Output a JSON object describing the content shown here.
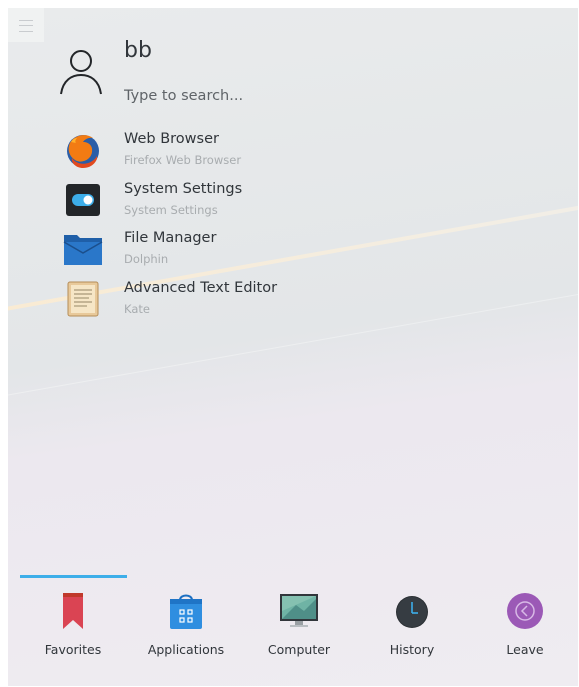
{
  "user": {
    "name": "bb"
  },
  "search": {
    "placeholder": "Type to search..."
  },
  "apps": [
    {
      "title": "Web Browser",
      "subtitle": "Firefox Web Browser",
      "icon": "firefox-icon"
    },
    {
      "title": "System Settings",
      "subtitle": "System Settings",
      "icon": "settings-toggle-icon"
    },
    {
      "title": "File Manager",
      "subtitle": "Dolphin",
      "icon": "folder-icon"
    },
    {
      "title": "Advanced Text Editor",
      "subtitle": "Kate",
      "icon": "text-editor-icon"
    }
  ],
  "tabs": [
    {
      "label": "Favorites",
      "icon": "bookmark-icon",
      "active": true
    },
    {
      "label": "Applications",
      "icon": "app-store-bag-icon",
      "active": false
    },
    {
      "label": "Computer",
      "icon": "monitor-icon",
      "active": false
    },
    {
      "label": "History",
      "icon": "clock-icon",
      "active": false
    },
    {
      "label": "Leave",
      "icon": "leave-icon",
      "active": false
    }
  ],
  "colors": {
    "accent": "#3daee9",
    "text": "#31363b",
    "subtext": "#a8acaf",
    "favorites": "#da4453",
    "leave": "#9b59b6"
  }
}
